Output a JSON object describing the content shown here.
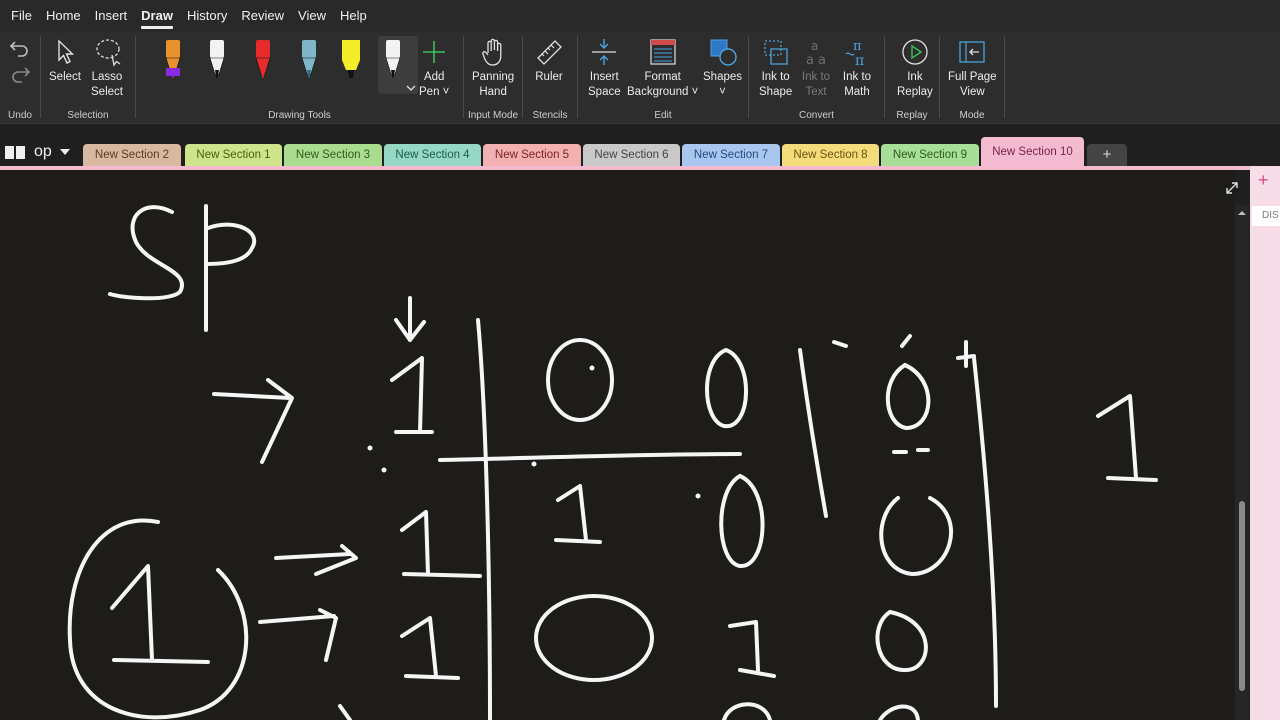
{
  "menu": [
    "File",
    "Home",
    "Insert",
    "Draw",
    "History",
    "Review",
    "View",
    "Help"
  ],
  "active_menu": "Draw",
  "ribbon": {
    "undo": {
      "label": "Undo"
    },
    "selection": {
      "label": "Selection",
      "select": "Select",
      "lasso_1": "Lasso",
      "lasso_2": "Select"
    },
    "drawing_tools": {
      "label": "Drawing Tools",
      "add_pen_1": "Add",
      "add_pen_2": "Pen ˅"
    },
    "input_mode": {
      "label": "Input Mode",
      "panning_1": "Panning",
      "panning_2": "Hand"
    },
    "stencils": {
      "label": "Stencils",
      "ruler": "Ruler"
    },
    "edit": {
      "label": "Edit",
      "insert_1": "Insert",
      "insert_2": "Space",
      "format_1": "Format",
      "format_2": "Background ˅",
      "shapes_1": "Shapes",
      "shapes_2": "˅"
    },
    "convert": {
      "label": "Convert",
      "ink_shape_1": "Ink to",
      "ink_shape_2": "Shape",
      "ink_text_1": "Ink to",
      "ink_text_2": "Text",
      "ink_math_1": "Ink to",
      "ink_math_2": "Math"
    },
    "replay": {
      "label": "Replay",
      "ink_replay_1": "Ink",
      "ink_replay_2": "Replay"
    },
    "mode": {
      "label": "Mode",
      "full_page_1": "Full Page",
      "full_page_2": "View"
    }
  },
  "pens": [
    {
      "name": "orange-pen",
      "color": "#e8912d",
      "tip": "#8a2be2"
    },
    {
      "name": "white-pen",
      "color": "#f2f2f2",
      "tip": "#111111"
    },
    {
      "name": "red-pen",
      "color": "#e52b2b",
      "tip": "#e52b2b"
    },
    {
      "name": "galaxy-pen",
      "color": "#7fb7c9",
      "tip": "#2f6e86"
    },
    {
      "name": "yellow-highlighter",
      "color": "#f4ee28",
      "tip": "#f4ee28"
    },
    {
      "name": "selected-white-pen",
      "color": "#f2f2f2",
      "tip": "#111111"
    }
  ],
  "notebook": {
    "name": "op"
  },
  "tabs": [
    {
      "label": "New Section 2",
      "color": "#d8b8a0",
      "text": "#5c3b23"
    },
    {
      "label": "New Section 1",
      "color": "#cde48a",
      "text": "#4b5e10"
    },
    {
      "label": "New Section 3",
      "color": "#a9dc8f",
      "text": "#2f5e1c"
    },
    {
      "label": "New Section 4",
      "color": "#96d8c4",
      "text": "#1c5c4a"
    },
    {
      "label": "New Section 5",
      "color": "#f2b0b0",
      "text": "#7a2424"
    },
    {
      "label": "New Section 6",
      "color": "#c9c9c9",
      "text": "#444444"
    },
    {
      "label": "New Section 7",
      "color": "#a9c7ee",
      "text": "#1f4a80"
    },
    {
      "label": "New Section 8",
      "color": "#f4dc7a",
      "text": "#6a5310"
    },
    {
      "label": "New Section 9",
      "color": "#a7de98",
      "text": "#2f5e1c"
    },
    {
      "label": "New Section 10",
      "color": "#f4bbd0",
      "text": "#7a2448"
    }
  ],
  "tab_add": "+",
  "sliver_text": "s",
  "page_panel": {
    "add": "+",
    "item": "DIS"
  },
  "colors": {
    "canvas": "#1e1c19",
    "ink": "#f5f5f5",
    "accent": "#f4bbd0"
  }
}
